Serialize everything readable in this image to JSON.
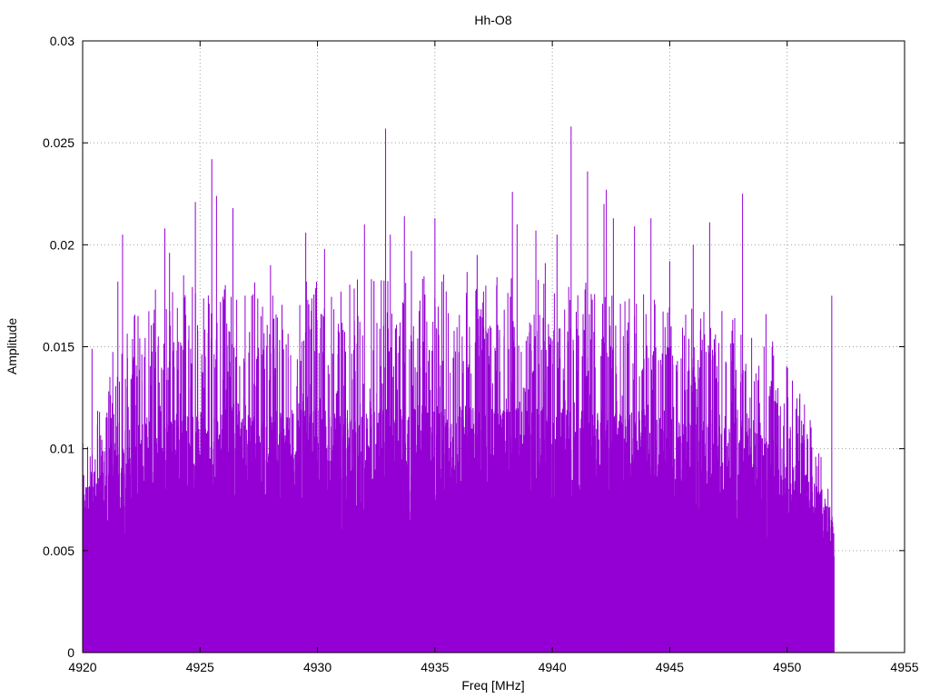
{
  "chart_data": {
    "type": "line",
    "title": "Hh-O8",
    "xlabel": "Freq [MHz]",
    "ylabel": "Amplitude",
    "xlim": [
      4920,
      4955
    ],
    "ylim": [
      0,
      0.03
    ],
    "x_ticks": [
      "4920",
      "4925",
      "4930",
      "4935",
      "4940",
      "4945",
      "4950",
      "4955"
    ],
    "y_ticks": [
      "0",
      "0.005",
      "0.01",
      "0.015",
      "0.02",
      "0.025",
      "0.03"
    ],
    "grid": true,
    "legend": "none",
    "line_color": "#9400d3",
    "series": [
      {
        "style": "impulses",
        "x_range": [
          4920,
          4952
        ],
        "typical_amplitude_band": [
          0.003,
          0.012
        ],
        "envelope": {
          "x": [
            4920,
            4921,
            4922,
            4924,
            4926,
            4928,
            4930,
            4932,
            4934,
            4936,
            4938,
            4940,
            4942,
            4944,
            4946,
            4948,
            4949,
            4950,
            4951,
            4951.9
          ],
          "y": [
            0.009,
            0.0125,
            0.0145,
            0.0155,
            0.0158,
            0.0158,
            0.016,
            0.0162,
            0.0163,
            0.0163,
            0.0162,
            0.016,
            0.0158,
            0.0155,
            0.015,
            0.0145,
            0.014,
            0.0125,
            0.0105,
            0.007
          ]
        },
        "peaks": {
          "x": [
            4920.4,
            4921.5,
            4921.7,
            4922.2,
            4923.1,
            4923.5,
            4923.7,
            4924.3,
            4924.8,
            4925.5,
            4925.7,
            4926.4,
            4927.2,
            4928.0,
            4929.5,
            4930.3,
            4931.0,
            4931.7,
            4932.0,
            4932.9,
            4933.1,
            4933.7,
            4934.0,
            4935.0,
            4935.3,
            4936.8,
            4938.3,
            4938.5,
            4939.3,
            4939.7,
            4940.2,
            4940.8,
            4941.5,
            4942.2,
            4942.3,
            4942.6,
            4943.5,
            4944.2,
            4945.0,
            4946.0,
            4946.7,
            4948.1,
            4949.1,
            4951.9
          ],
          "y": [
            0.0149,
            0.0182,
            0.0205,
            0.0165,
            0.0178,
            0.0208,
            0.0196,
            0.0185,
            0.0221,
            0.0242,
            0.0224,
            0.0218,
            0.0175,
            0.019,
            0.0206,
            0.0198,
            0.0177,
            0.0183,
            0.021,
            0.0257,
            0.0205,
            0.0214,
            0.0197,
            0.0213,
            0.0182,
            0.0195,
            0.0226,
            0.021,
            0.0207,
            0.0191,
            0.0205,
            0.0258,
            0.0236,
            0.022,
            0.0227,
            0.0213,
            0.0209,
            0.0213,
            0.0192,
            0.02,
            0.0211,
            0.0225,
            0.0166,
            0.0175
          ]
        }
      }
    ]
  }
}
